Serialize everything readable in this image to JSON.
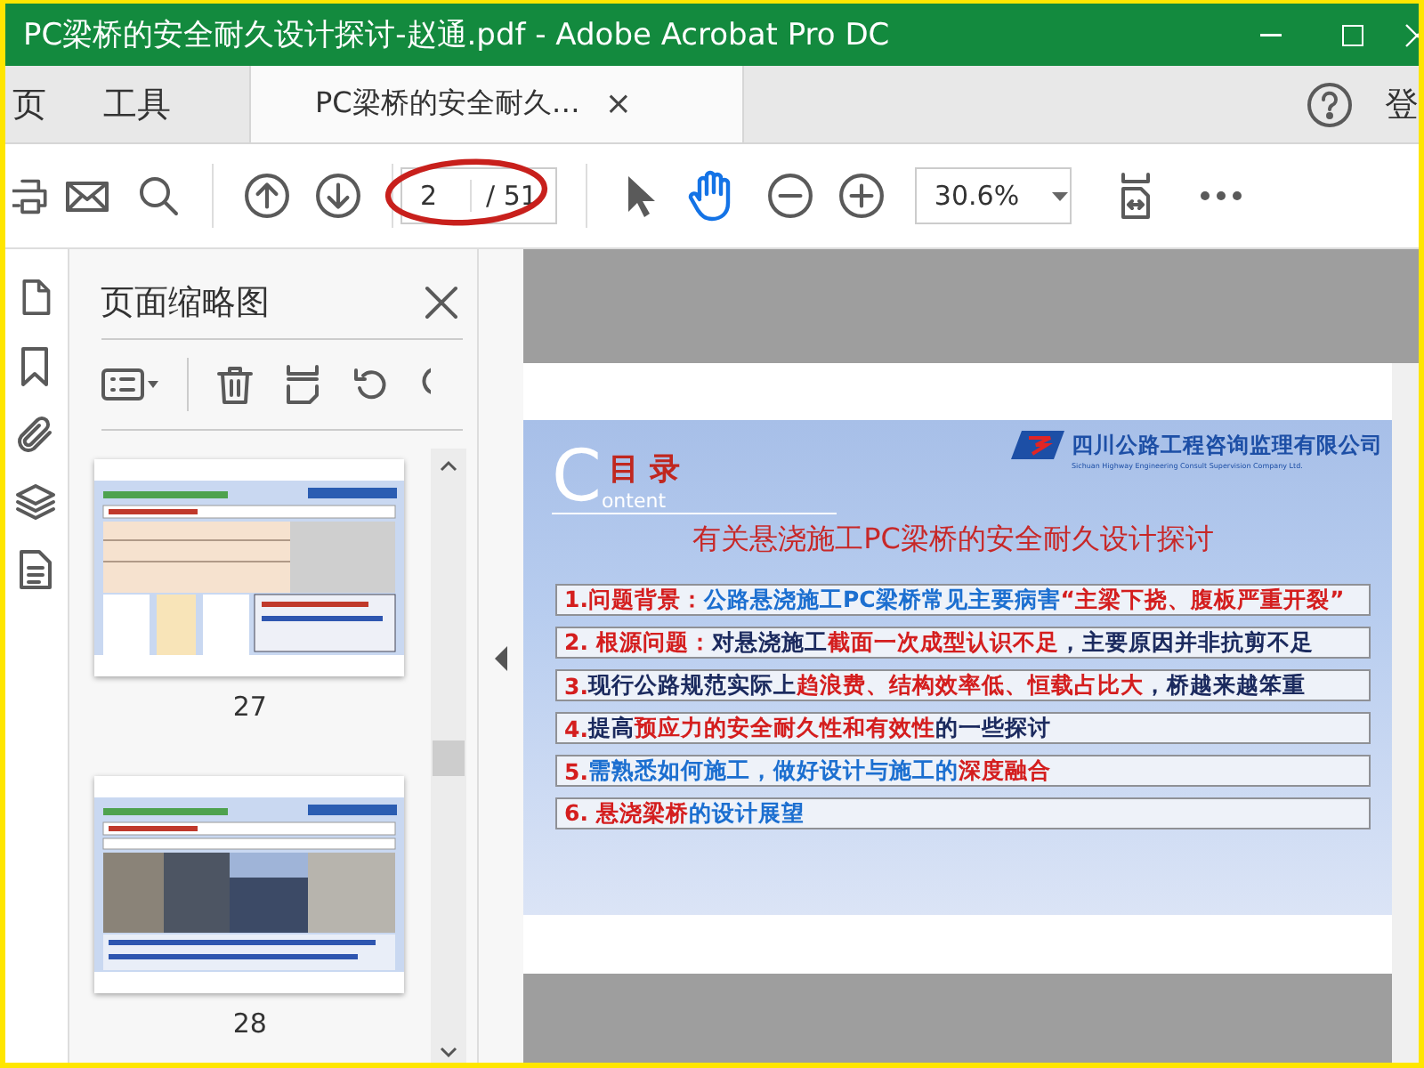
{
  "window": {
    "title": "PC梁桥的安全耐久设计探讨-赵通.pdf - Adobe Acrobat Pro DC"
  },
  "tabs": [
    {
      "label": "页",
      "selected": false,
      "kind": "nav"
    },
    {
      "label": "工具",
      "selected": false,
      "kind": "nav"
    },
    {
      "label": "PC梁桥的安全耐久…",
      "selected": true,
      "kind": "document",
      "close": "×"
    }
  ],
  "account": {
    "label": "登"
  },
  "toolbar": {
    "page_number": "2",
    "page_count": "/ 51",
    "zoom": "30.6%",
    "tools": [
      {
        "kind": "select",
        "selected": false
      },
      {
        "kind": "hand",
        "selected": true
      }
    ]
  },
  "thumbnail_panel": {
    "title": "页面缩略图",
    "pages": [
      {
        "label": "27",
        "kind": "table-slide"
      },
      {
        "label": "28",
        "kind": "photo-slide"
      }
    ]
  },
  "slide": {
    "heading_initial": "C",
    "heading": "目 录",
    "heading_rest": "ontent",
    "company": "四川公路工程咨询监理有限公司",
    "company_en": "Sichuan Highway Engineering Consult Supervision Company Ltd.",
    "title": "有关悬浇施工PC梁桥的安全耐久设计探讨",
    "items": [
      {
        "kind": "blue",
        "segments": [
          {
            "text": "1.问题背景：",
            "highlight": true
          },
          {
            "text": "公路悬浇施工PC梁桥常见主要病害",
            "highlight": false
          },
          {
            "text": "“主梁下挠、腹板严重开裂”",
            "highlight": true
          }
        ]
      },
      {
        "kind": "navy",
        "segments": [
          {
            "text": "2. 根源问题：",
            "highlight": true
          },
          {
            "text": "对悬浇施工",
            "highlight": false
          },
          {
            "text": "截面一次成型认识不足",
            "highlight": true
          },
          {
            "text": "，主要原因并非抗剪不足",
            "highlight": false
          }
        ]
      },
      {
        "kind": "navy",
        "segments": [
          {
            "text": "3. ",
            "highlight": true
          },
          {
            "text": "现行公路规范实际上",
            "highlight": false
          },
          {
            "text": "趋浪费、结构效率低、恒载占比大",
            "highlight": true
          },
          {
            "text": "，桥越来越笨重",
            "highlight": false
          }
        ]
      },
      {
        "kind": "navy",
        "segments": [
          {
            "text": "4. ",
            "highlight": true
          },
          {
            "text": "提高",
            "highlight": false
          },
          {
            "text": "预应力的安全耐久性和有效性",
            "highlight": true
          },
          {
            "text": "的一些探讨",
            "highlight": false
          }
        ]
      },
      {
        "kind": "blue",
        "segments": [
          {
            "text": "5.  ",
            "highlight": true
          },
          {
            "text": "需熟悉如何施工，做好设计与施工的",
            "highlight": false
          },
          {
            "text": "深度融合",
            "highlight": true
          }
        ]
      },
      {
        "kind": "blue",
        "segments": [
          {
            "text": "6.  悬浇梁桥",
            "highlight": true
          },
          {
            "text": "的设计展望",
            "highlight": false
          }
        ]
      }
    ]
  }
}
